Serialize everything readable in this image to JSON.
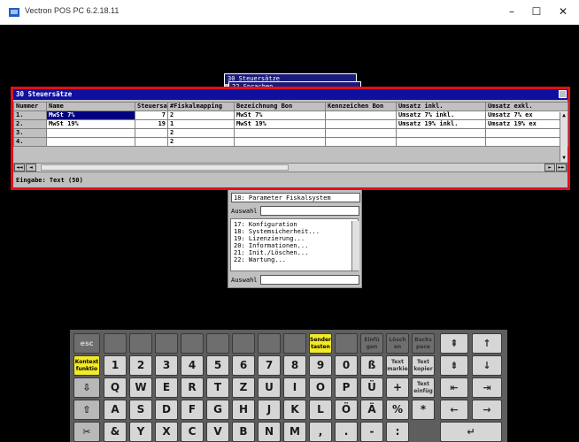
{
  "window": {
    "title": "Vectron POS PC 6.2.18.11",
    "minimize": "–",
    "maximize": "☐",
    "close": "✕"
  },
  "background_windows": [
    {
      "title": "30 Steuersätze"
    },
    {
      "title": "22 Sprachen..."
    }
  ],
  "menu_window": {
    "param_item": "18: Parameter Fiskalsystem",
    "auswahl_label_1": "Auswahl",
    "items": [
      "17: Konfiguration",
      "18: Systemsicherheit...",
      "19: Lizenzierung...",
      "20: Informationen...",
      "21: Init./Löschen...",
      "22: Wartung..."
    ],
    "auswahl_label_2": "Auswahl"
  },
  "main_window": {
    "title": "30 Steuersätze",
    "columns": [
      "Nummer",
      "Name",
      "Steuersatz",
      "#Fiskalmapping",
      "Bezeichnung Bon",
      "Kennzeichen Bon",
      "Umsatz inkl.",
      "Umsatz exkl."
    ],
    "rows": [
      [
        "1.",
        "MwSt 7%",
        "7",
        "2",
        "MwSt 7%",
        "",
        "Umsatz  7% inkl.",
        "Umsatz  7% ex"
      ],
      [
        "2.",
        "MwSt 19%",
        "19",
        "1",
        "MwSt 19%",
        "",
        "Umsatz 19% inkl.",
        "Umsatz 19% ex"
      ],
      [
        "3.",
        "",
        "",
        "2",
        "",
        "",
        "",
        ""
      ],
      [
        "4.",
        "",
        "",
        "2",
        "",
        "",
        "",
        ""
      ]
    ],
    "status": "Eingabe: Text (50)"
  },
  "keyboard": {
    "top_row": [
      "esc",
      "",
      "",
      "",
      "",
      "",
      "",
      "",
      "",
      "Sender tasten",
      "",
      "Einfü gen",
      "Lösch en",
      "Backs pace"
    ],
    "num_row": [
      "Kontext funktio",
      "1",
      "2",
      "3",
      "4",
      "5",
      "6",
      "7",
      "8",
      "9",
      "0",
      "ß",
      "Text markie",
      "Text kopier"
    ],
    "qwertz_row": [
      "⇩",
      "Q",
      "W",
      "E",
      "R",
      "T",
      "Z",
      "U",
      "I",
      "O",
      "P",
      "Ü",
      "+",
      "Text einfüg"
    ],
    "asdf_row": [
      "⇧",
      "A",
      "S",
      "D",
      "F",
      "G",
      "H",
      "J",
      "K",
      "L",
      "Ö",
      "Ä",
      "%",
      "*"
    ],
    "yxcv_row": [
      "✂",
      "&",
      "Y",
      "X",
      "C",
      "V",
      "B",
      "N",
      "M",
      ",",
      ".",
      "-",
      ":"
    ],
    "nav": {
      "top_up": "⇞",
      "up": "↑",
      "down_page": "⇟",
      "down": "↓",
      "home": "⇤",
      "end": "⇥",
      "left": "←",
      "right": "→",
      "enter": "↵"
    }
  }
}
